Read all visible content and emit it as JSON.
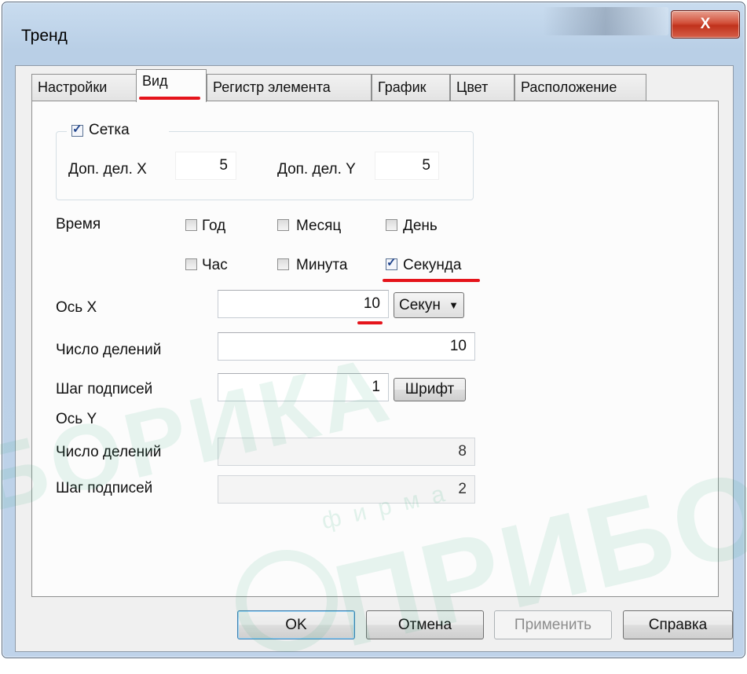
{
  "window": {
    "title": "Тренд",
    "close_glyph": "X"
  },
  "tabs": [
    {
      "label": "Настройки"
    },
    {
      "label": "Вид"
    },
    {
      "label": "Регистр элемента"
    },
    {
      "label": "График"
    },
    {
      "label": "Цвет"
    },
    {
      "label": "Расположение"
    }
  ],
  "grid": {
    "checkbox_label": "Сетка",
    "checked": true,
    "x_label": "Доп. дел. X",
    "x_value": "5",
    "y_label": "Доп. дел. Y",
    "y_value": "5"
  },
  "time": {
    "label": "Время",
    "year": "Год",
    "month": "Месяц",
    "day": "День",
    "hour": "Час",
    "minute": "Минута",
    "second": "Секунда"
  },
  "axis_x": {
    "label": "Ось X",
    "value": "10",
    "unit": "Секун",
    "divisions_label": "Число делений",
    "divisions_value": "10",
    "step_label": "Шаг подписей",
    "step_value": "1",
    "font_button": "Шрифт"
  },
  "axis_y": {
    "label": "Ось Y",
    "divisions_label": "Число делений",
    "divisions_value": "8",
    "step_label": "Шаг подписей",
    "step_value": "2"
  },
  "buttons": {
    "ok": "OK",
    "cancel": "Отмена",
    "apply": "Применить",
    "help": "Справка"
  },
  "watermark": {
    "top_text": "БОРИКА",
    "small_text": "фирма",
    "bottom_text": "ПРИБОРИ"
  },
  "colors": {
    "highlight": "#e5141b",
    "watermark": "#2aa873"
  }
}
